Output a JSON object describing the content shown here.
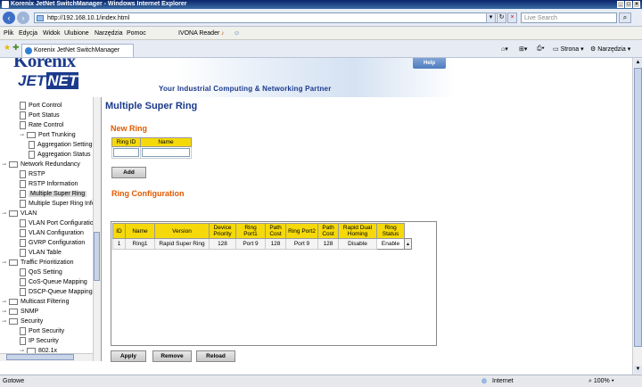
{
  "window": {
    "title": "Korenix JetNet SwitchManager - Windows Internet Explorer"
  },
  "nav": {
    "url": "http://192.168.10.1/index.html",
    "search_placeholder": "Live Search"
  },
  "menu": {
    "items": [
      "Plik",
      "Edycja",
      "Widok",
      "Ulubione",
      "Narzędzia",
      "Pomoc"
    ],
    "ivona": "IVONA Reader"
  },
  "favbar": {
    "tab_title": "Korenix JetNet SwitchManager",
    "strona": "Strona",
    "narzedzia": "Narzędzia"
  },
  "banner": {
    "logo_top": "Korenix",
    "logo_jet": "JET",
    "logo_net": "NET",
    "help": "Help",
    "tagline": "Your Industrial Computing & Networking Partner"
  },
  "tree": [
    {
      "label": "Port Control",
      "type": "doc",
      "indent": 2
    },
    {
      "label": "Port Status",
      "type": "doc",
      "indent": 2
    },
    {
      "label": "Rate Control",
      "type": "doc",
      "indent": 2
    },
    {
      "label": "Port Trunking",
      "type": "fold",
      "indent": 2
    },
    {
      "label": "Aggregation Setting",
      "type": "doc",
      "indent": 3
    },
    {
      "label": "Aggregation Status",
      "type": "doc",
      "indent": 3
    },
    {
      "label": "Network Redundancy",
      "type": "fold",
      "indent": 1
    },
    {
      "label": "RSTP",
      "type": "doc",
      "indent": 2
    },
    {
      "label": "RSTP Information",
      "type": "doc",
      "indent": 2
    },
    {
      "label": "Multiple Super Ring",
      "type": "doc",
      "indent": 2,
      "selected": true
    },
    {
      "label": "Multiple Super Ring Info",
      "type": "doc",
      "indent": 2
    },
    {
      "label": "VLAN",
      "type": "fold",
      "indent": 1
    },
    {
      "label": "VLAN Port Configuration",
      "type": "doc",
      "indent": 2
    },
    {
      "label": "VLAN Configuration",
      "type": "doc",
      "indent": 2
    },
    {
      "label": "GVRP Configuration",
      "type": "doc",
      "indent": 2
    },
    {
      "label": "VLAN Table",
      "type": "doc",
      "indent": 2
    },
    {
      "label": "Traffic Prioritization",
      "type": "fold",
      "indent": 1
    },
    {
      "label": "QoS Setting",
      "type": "doc",
      "indent": 2
    },
    {
      "label": "CoS-Queue Mapping",
      "type": "doc",
      "indent": 2
    },
    {
      "label": "DSCP-Queue Mapping",
      "type": "doc",
      "indent": 2
    },
    {
      "label": "Multicast Filtering",
      "type": "fold",
      "indent": 1
    },
    {
      "label": "SNMP",
      "type": "fold",
      "indent": 1
    },
    {
      "label": "Security",
      "type": "fold",
      "indent": 1
    },
    {
      "label": "Port Security",
      "type": "doc",
      "indent": 2
    },
    {
      "label": "IP Security",
      "type": "doc",
      "indent": 2
    },
    {
      "label": "802.1x",
      "type": "fold",
      "indent": 2
    }
  ],
  "main": {
    "title": "Multiple Super Ring",
    "new_ring": {
      "heading": "New Ring",
      "col_id": "Ring ID",
      "col_name": "Name",
      "add": "Add"
    },
    "ring_config": {
      "heading": "Ring Configuration",
      "headers": [
        "ID",
        "Name",
        "Version",
        "Device Priority",
        "Ring Port1",
        "Path Cost",
        "Ring Port2",
        "Path Cost",
        "Rapid Dual Homing",
        "Ring Status"
      ],
      "rows": [
        [
          "1",
          "Ring1",
          "Rapid Super Ring",
          "128",
          "Port 9",
          "128",
          "Port 9",
          "128",
          "Disable",
          "Enable"
        ]
      ]
    },
    "buttons": {
      "apply": "Apply",
      "remove": "Remove",
      "reload": "Reload"
    }
  },
  "status": {
    "left": "Gotowe",
    "zone": "Internet",
    "zoom": "100%"
  }
}
